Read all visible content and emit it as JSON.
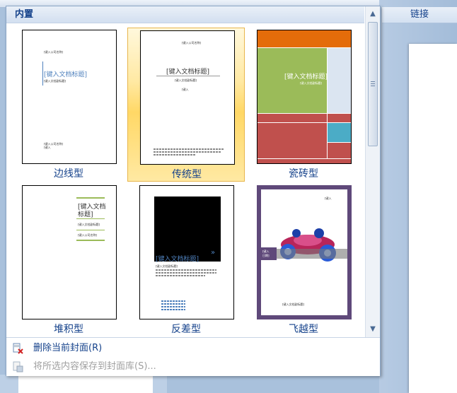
{
  "background": {
    "link_label": "链接"
  },
  "panel": {
    "header": "内置",
    "items": [
      {
        "label": "边线型"
      },
      {
        "label": "传统型"
      },
      {
        "label": "瓷砖型"
      },
      {
        "label": "堆积型"
      },
      {
        "label": "反差型"
      },
      {
        "label": "飞越型"
      }
    ],
    "thumb_text": {
      "title": "[键入文档标题]",
      "subtitle": "[键入文档副标题]",
      "company": "[键入公司名称]",
      "title_line1": "[键入文档",
      "title_line2": "标题]",
      "date_box_line1": "[键入",
      "date_box_line2": "日期]"
    }
  },
  "footer": {
    "remove_label": "删除当前封面(R)",
    "save_label": "将所选内容保存到封面库(S)..."
  },
  "colors": {
    "accent": "#15428b",
    "selection": "#ffd866",
    "tile_orange": "#e46c0a",
    "tile_green": "#9bbb59",
    "tile_red": "#c0504d",
    "tile_blue": "#4bacc6"
  }
}
